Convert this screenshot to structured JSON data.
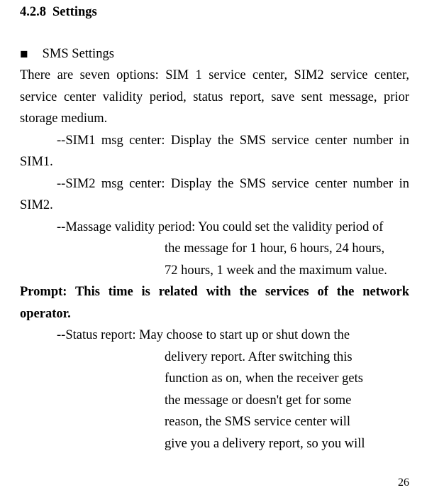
{
  "heading": {
    "number": "4.2.8",
    "title": "Settings"
  },
  "bullet": {
    "title": "SMS Settings"
  },
  "intro": "There are seven options: SIM 1 service center, SIM2 service center, service center validity period, status report, save sent message, prior storage medium.",
  "items": {
    "sim1": "--SIM1 msg center: Display the SMS service center number in SIM1.",
    "sim2": "--SIM2 msg center: Display the SMS service center number in SIM2.",
    "validity_lead": "--Massage validity period: You could set the validity period of",
    "validity_cont1": "the message for 1 hour, 6 hours, 24 hours,",
    "validity_cont2": "72 hours, 1 week and the maximum value.",
    "prompt": "Prompt: This time is related with the services of the network operator.",
    "status_lead": "--Status report: May choose to start up or shut down the",
    "status_cont1": "delivery report. After switching this",
    "status_cont2": "function as on, when the receiver gets",
    "status_cont3": "the message or doesn't get for some",
    "status_cont4": "reason, the SMS service center will",
    "status_cont5": "give you a delivery report, so you will"
  },
  "pageNumber": "26"
}
